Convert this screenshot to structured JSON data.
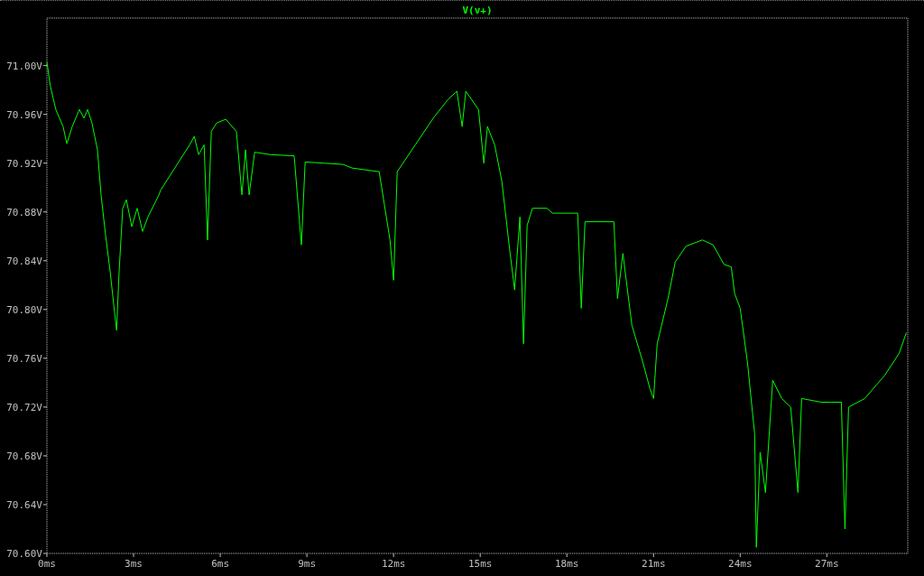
{
  "plot": {
    "chart_data": {
      "type": "line",
      "xlim": [
        0,
        29.8
      ],
      "ylim": [
        70.6,
        71.039
      ],
      "xticks": [
        {
          "value": 0,
          "label": "0ms"
        },
        {
          "value": 3,
          "label": "3ms"
        },
        {
          "value": 6,
          "label": "6ms"
        },
        {
          "value": 9,
          "label": "9ms"
        },
        {
          "value": 12,
          "label": "12ms"
        },
        {
          "value": 15,
          "label": "15ms"
        },
        {
          "value": 18,
          "label": "18ms"
        },
        {
          "value": 21,
          "label": "21ms"
        },
        {
          "value": 24,
          "label": "24ms"
        },
        {
          "value": 27,
          "label": "27ms"
        }
      ],
      "yticks": [
        {
          "value": 70.6,
          "label": "70.60V"
        },
        {
          "value": 70.64,
          "label": "70.64V"
        },
        {
          "value": 70.68,
          "label": "70.68V"
        },
        {
          "value": 70.72,
          "label": "70.72V"
        },
        {
          "value": 70.76,
          "label": "70.76V"
        },
        {
          "value": 70.8,
          "label": "70.80V"
        },
        {
          "value": 70.84,
          "label": "70.84V"
        },
        {
          "value": 70.88,
          "label": "70.88V"
        },
        {
          "value": 70.92,
          "label": "70.92V"
        },
        {
          "value": 70.96,
          "label": "70.96V"
        },
        {
          "value": 71.0,
          "label": "71.00V"
        }
      ],
      "x": [
        0,
        0.12,
        0.31,
        0.56,
        0.69,
        0.875,
        1.125,
        1.28,
        1.41,
        1.56,
        1.75,
        1.875,
        2.03,
        2.19,
        2.34,
        2.41,
        2.5,
        2.625,
        2.75,
        2.94,
        3.125,
        3.31,
        3.5,
        3.875,
        3.94,
        4.94,
        5.1,
        5.25,
        5.44,
        5.56,
        5.69,
        5.875,
        6.19,
        6.56,
        6.75,
        6.875,
        7,
        7.19,
        7.75,
        8.56,
        8.81,
        8.94,
        10.25,
        10.56,
        11.5,
        11.875,
        12,
        12.125,
        12.75,
        13.375,
        13.875,
        14.19,
        14.375,
        14.5,
        14.94,
        15.125,
        15.25,
        15.5,
        15.75,
        16,
        16.19,
        16.375,
        16.5,
        16.625,
        16.81,
        17.31,
        17.5,
        18.375,
        18.5,
        18.625,
        19.625,
        19.75,
        19.94,
        20.25,
        20.625,
        20.875,
        21,
        21.125,
        21.5,
        21.75,
        22.125,
        22.69,
        23.06,
        23.44,
        23.69,
        23.81,
        24,
        24.25,
        24.5,
        24.56,
        24.69,
        24.875,
        25.125,
        25.44,
        25.75,
        26,
        26.125,
        26.81,
        27.125,
        27.5,
        27.625,
        27.75,
        28.31,
        29,
        29.5,
        29.75
      ],
      "series": [
        {
          "name": "V(v+)",
          "color": "#00ff00",
          "values": [
            71.003,
            70.983,
            70.964,
            70.95,
            70.936,
            70.95,
            70.964,
            70.957,
            70.964,
            70.953,
            70.931,
            70.894,
            70.861,
            70.831,
            70.798,
            70.783,
            70.831,
            70.883,
            70.89,
            70.868,
            70.883,
            70.864,
            70.876,
            70.894,
            70.898,
            70.935,
            70.942,
            70.927,
            70.935,
            70.857,
            70.946,
            70.953,
            70.956,
            70.946,
            70.894,
            70.931,
            70.894,
            70.929,
            70.927,
            70.926,
            70.853,
            70.921,
            70.919,
            70.916,
            70.913,
            70.857,
            70.824,
            70.913,
            70.935,
            70.957,
            70.972,
            70.979,
            70.95,
            70.979,
            70.964,
            70.92,
            70.95,
            70.935,
            70.905,
            70.853,
            70.816,
            70.876,
            70.772,
            70.869,
            70.883,
            70.883,
            70.879,
            70.879,
            70.801,
            70.872,
            70.872,
            70.809,
            70.846,
            70.787,
            70.757,
            70.735,
            70.727,
            70.772,
            70.809,
            70.839,
            70.852,
            70.857,
            70.853,
            70.837,
            70.835,
            70.813,
            70.801,
            70.757,
            70.698,
            70.605,
            70.683,
            70.65,
            70.742,
            70.727,
            70.72,
            70.65,
            70.727,
            70.724,
            70.724,
            70.724,
            70.62,
            70.72,
            70.727,
            70.746,
            70.764,
            70.781
          ]
        }
      ]
    }
  }
}
